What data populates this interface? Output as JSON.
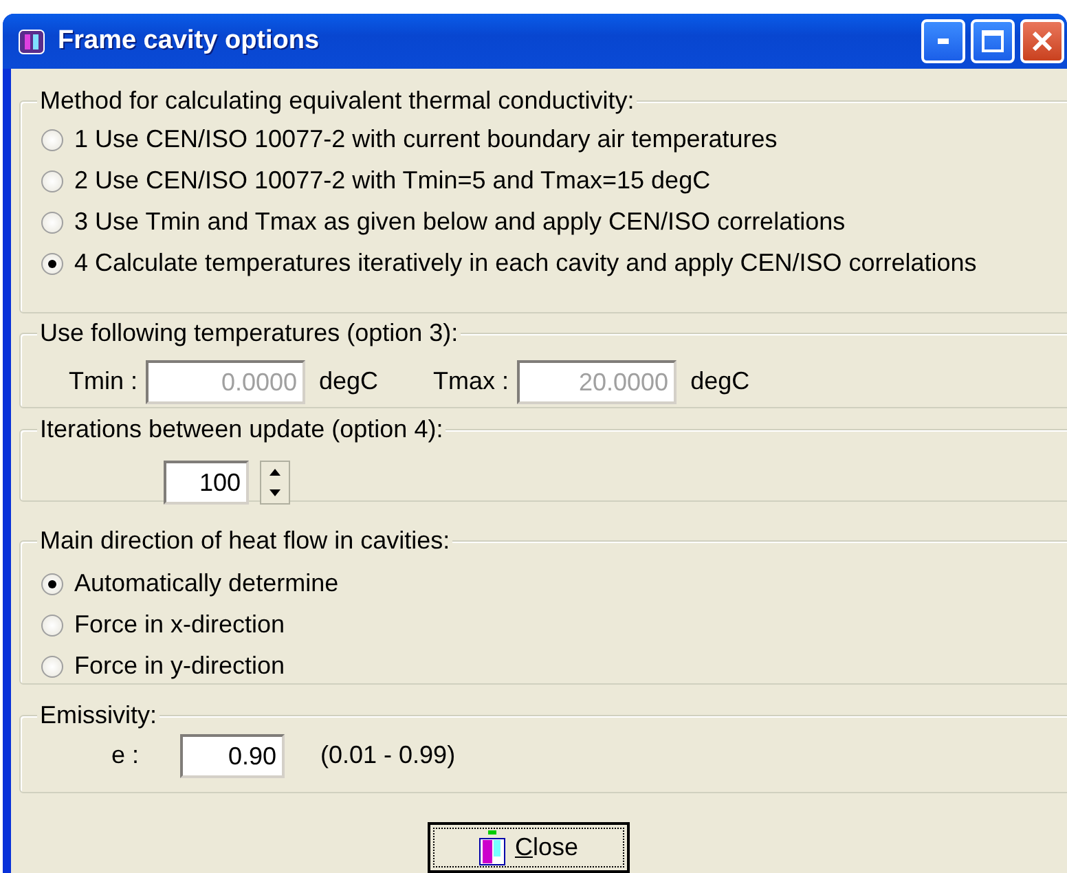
{
  "window": {
    "title": "Frame cavity options"
  },
  "method": {
    "legend": "Method for calculating equivalent thermal conductivity:",
    "options": [
      {
        "label": "1 Use CEN/ISO 10077-2 with current boundary air temperatures",
        "selected": false
      },
      {
        "label": "2 Use CEN/ISO 10077-2 with Tmin=5 and Tmax=15 degC",
        "selected": false
      },
      {
        "label": "3 Use Tmin and Tmax as given below and apply CEN/ISO correlations",
        "selected": false
      },
      {
        "label": "4 Calculate temperatures iteratively in each cavity and apply CEN/ISO correlations",
        "selected": true
      }
    ]
  },
  "temperatures": {
    "legend": "Use following temperatures (option 3):",
    "fields": [
      {
        "label": "Tmin :",
        "value": "0.0000",
        "unit": "degC",
        "disabled": true
      },
      {
        "label": "Tmax :",
        "value": "20.0000",
        "unit": "degC",
        "disabled": true
      }
    ]
  },
  "iterations": {
    "legend": "Iterations between update (option 4):",
    "value": "100"
  },
  "heat_flow": {
    "legend": "Main direction of heat flow in cavities:",
    "options": [
      {
        "label": "Automatically determine",
        "selected": true
      },
      {
        "label": "Force in x-direction",
        "selected": false
      },
      {
        "label": "Force in y-direction",
        "selected": false
      }
    ]
  },
  "emissivity": {
    "legend": "Emissivity:",
    "label": "e :",
    "value": "0.90",
    "range": "(0.01 - 0.99)"
  },
  "buttons": [
    {
      "label": "Close"
    }
  ]
}
